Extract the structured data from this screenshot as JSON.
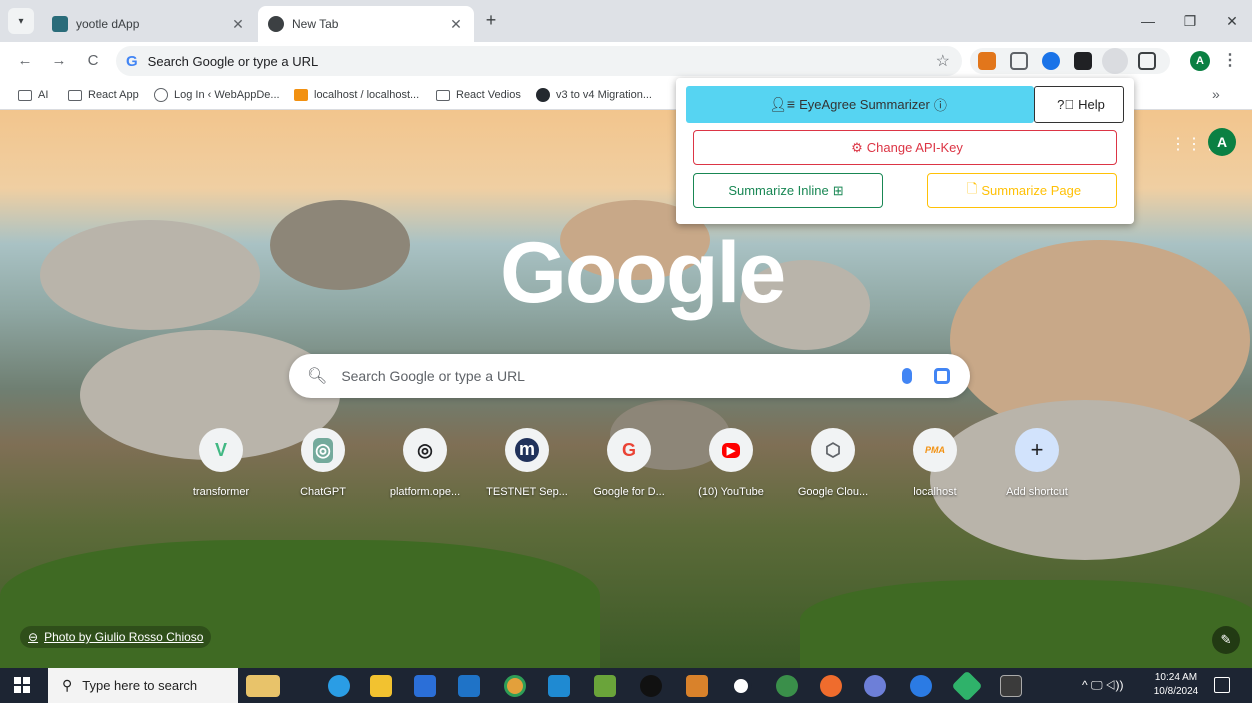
{
  "browser": {
    "tabs": [
      {
        "title": "yootle dApp",
        "active": false
      },
      {
        "title": "New Tab",
        "active": true
      }
    ],
    "new_tab_symbol": "+",
    "omnibox": {
      "text": "Search Google or type a URL"
    },
    "window_controls": {
      "minimize": "—",
      "restore": "❐",
      "close": "✕"
    },
    "profile_initial": "A"
  },
  "bookmarks": [
    {
      "label": "AI",
      "icon": "folder-icon"
    },
    {
      "label": "React App",
      "icon": "folder-icon"
    },
    {
      "label": "Log In ‹ WebAppDe...",
      "icon": "globe-icon"
    },
    {
      "label": "localhost / localhost...",
      "icon": "phpmyadmin-icon"
    },
    {
      "label": "React Vedios",
      "icon": "folder-icon"
    },
    {
      "label": "v3 to v4 Migration...",
      "icon": "github-icon"
    }
  ],
  "bookmarks_overflow": "»",
  "popup": {
    "title": "EyeAgree Summarizer",
    "help": "Help",
    "change_api_key": "Change API-Key",
    "summarize_inline": "Summarize Inline",
    "summarize_page": "Summarize Page"
  },
  "ntp": {
    "logo": "Google",
    "search_placeholder": "Search Google or type a URL",
    "profile_initial": "A",
    "shortcuts": [
      {
        "label": "transformer",
        "glyph": "V",
        "color": "#41b883"
      },
      {
        "label": "ChatGPT",
        "glyph": "◎",
        "color": "#74aa9c"
      },
      {
        "label": "platform.ope...",
        "glyph": "◎",
        "color": "#202124"
      },
      {
        "label": "TESTNET Sep...",
        "glyph": "m",
        "color": "#21325b"
      },
      {
        "label": "Google for D...",
        "glyph": "G",
        "color": "#ea4335"
      },
      {
        "label": "(10) YouTube",
        "glyph": "▶",
        "color": "#ff0000"
      },
      {
        "label": "Google Clou...",
        "glyph": "⬡",
        "color": "#5f6368"
      },
      {
        "label": "localhost",
        "glyph": "PMA",
        "color": "#f29111"
      },
      {
        "label": "Add shortcut",
        "glyph": "+",
        "color": "#202124"
      }
    ],
    "photo_credit": "Photo by Giulio Rosso Chioso"
  },
  "taskbar": {
    "search_placeholder": "Type here to search",
    "time": "10:24 AM",
    "date": "10/8/2024",
    "tray": "^ 🖵 ◁))"
  },
  "colors": {
    "popup_header": "#56d4f2",
    "danger": "#dc3545",
    "success": "#198754",
    "warning": "#ffc107",
    "taskbar": "#1d2533"
  }
}
